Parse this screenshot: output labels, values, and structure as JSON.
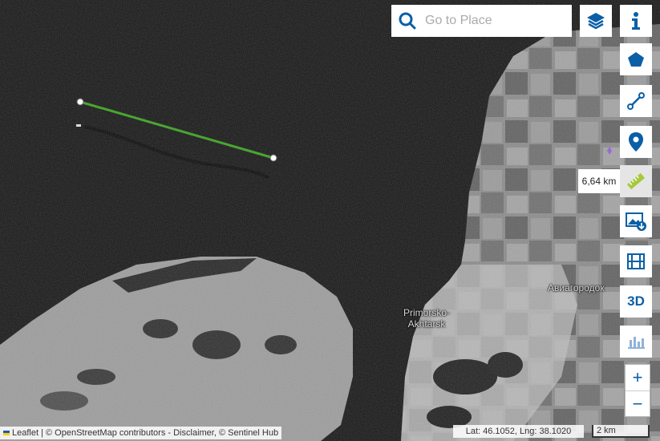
{
  "search": {
    "placeholder": "Go to Place"
  },
  "toolbar": [
    {
      "name": "layers-button",
      "icon": "layers-icon"
    },
    {
      "name": "info-button",
      "icon": "info-icon"
    },
    {
      "name": "draw-polygon-button",
      "icon": "pentagon-icon"
    },
    {
      "name": "draw-line-button",
      "icon": "line-icon"
    },
    {
      "name": "poi-button",
      "icon": "map-pin-icon"
    },
    {
      "name": "measure-button",
      "icon": "ruler-icon"
    },
    {
      "name": "download-image-button",
      "icon": "image-download-icon"
    },
    {
      "name": "timelapse-button",
      "icon": "film-icon"
    },
    {
      "name": "3d-button",
      "label": "3D"
    },
    {
      "name": "histogram-button",
      "icon": "chart-icon"
    }
  ],
  "measurement": {
    "distance": "6,64 km"
  },
  "zoom": {
    "in": "+",
    "out": "−"
  },
  "map_labels": {
    "city": "Primorsko-Akhtarsk",
    "district": "Авиагородок"
  },
  "attribution": {
    "text": "Leaflet | © OpenStreetMap contributors - Disclaimer, © Sentinel Hub"
  },
  "coordinates": {
    "text": "Lat: 46.1052, Lng: 38.1020"
  },
  "scale": {
    "label": "2 km"
  },
  "colors": {
    "accent": "#0a5fa7",
    "measure_line": "#4aa532"
  }
}
